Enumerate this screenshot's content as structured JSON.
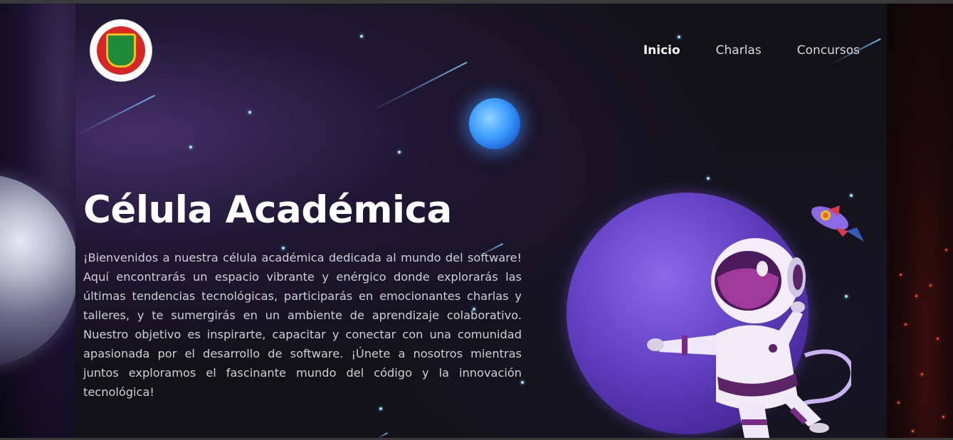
{
  "nav": {
    "items": [
      {
        "label": "Inicio",
        "active": true
      },
      {
        "label": "Charlas",
        "active": false
      },
      {
        "label": "Concursos",
        "active": false
      }
    ]
  },
  "hero": {
    "title": "Célula Académica",
    "description": "¡Bienvenidos a nuestra célula académica dedicada al mundo del software! Aquí encontrarás un espacio vibrante y enérgico donde explorarás las últimas tendencias tecnológicas, participarás en emocionantes charlas y talleres, y te sumergirás en un ambiente de aprendizaje colaborativo. Nuestro objetivo es inspirarte, capacitar y conectar con una comunidad apasionada por el desarrollo de software. ¡Únete a nosotros mientras juntos exploramos el fascinante mundo del código y la innovación tecnológica!"
  },
  "icons": {
    "logo": "faculty-crest-icon",
    "blue_planet": "blue-planet-icon",
    "purple_planet": "purple-planet-icon",
    "astronaut": "astronaut-icon",
    "rocket": "rocket-icon"
  },
  "colors": {
    "background": "#121117",
    "text": "#cfcfd6",
    "title": "#ffffff",
    "accent_purple": "#6a48cc",
    "accent_blue": "#3c9cff"
  }
}
